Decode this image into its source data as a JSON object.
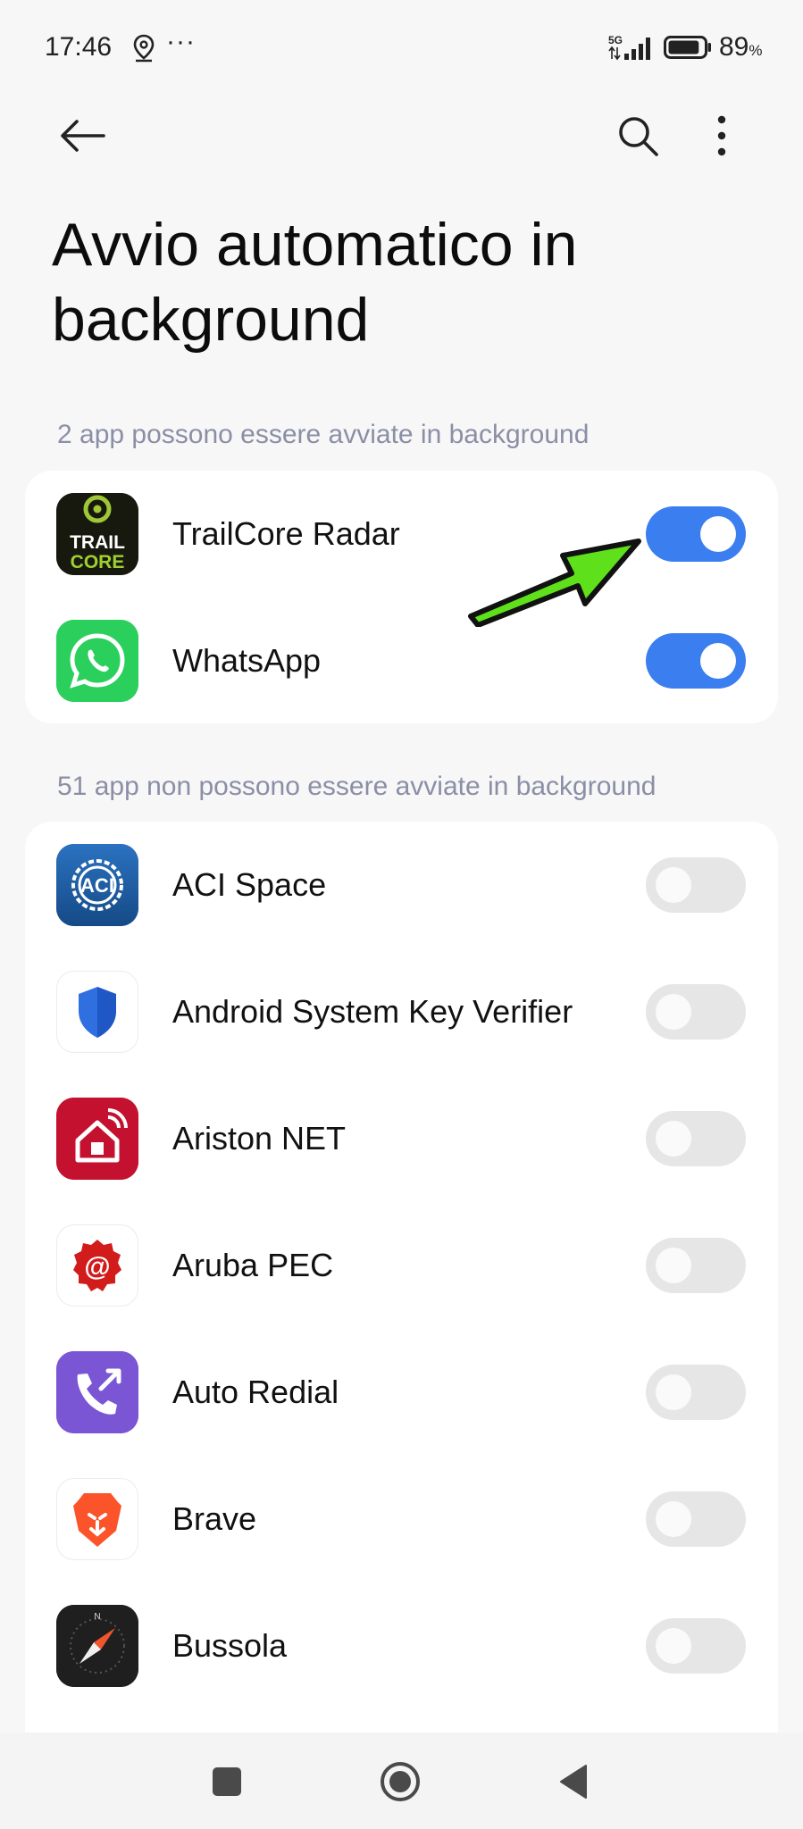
{
  "status_bar": {
    "time": "17:46",
    "dots": "···",
    "network": "5G",
    "battery_percent": "89",
    "battery_unit": "%",
    "battery_level": 0.89
  },
  "header": {
    "title": "Avvio automatico in background",
    "back_icon": "arrow-left-icon",
    "search_icon": "search-icon",
    "more_icon": "more-vertical-icon"
  },
  "enabled_section": {
    "header": "2 app possono essere avviate in background",
    "apps": [
      {
        "name": "TrailCore Radar",
        "enabled": true,
        "icon": "trailcore-icon",
        "icon_text_1": "TRAIL",
        "icon_text_2": "CORE"
      },
      {
        "name": "WhatsApp",
        "enabled": true,
        "icon": "whatsapp-icon"
      }
    ]
  },
  "disabled_section": {
    "header": "51 app non possono essere avviate in background",
    "apps": [
      {
        "name": "ACI Space",
        "enabled": false,
        "icon": "aci-space-icon"
      },
      {
        "name": "Android System Key Verifier",
        "enabled": false,
        "icon": "shield-icon"
      },
      {
        "name": "Ariston NET",
        "enabled": false,
        "icon": "ariston-home-icon"
      },
      {
        "name": "Aruba PEC",
        "enabled": false,
        "icon": "aruba-pec-icon"
      },
      {
        "name": "Auto Redial",
        "enabled": false,
        "icon": "phone-redial-icon"
      },
      {
        "name": "Brave",
        "enabled": false,
        "icon": "brave-lion-icon"
      },
      {
        "name": "Bussola",
        "enabled": false,
        "icon": "compass-icon"
      }
    ]
  },
  "annotation": {
    "icon": "green-arrow-icon",
    "color": "#5ee01a"
  },
  "colors": {
    "toggle_on": "#3a7ef0",
    "toggle_off": "#e6e6e6",
    "section_header": "#8b8fa6"
  },
  "nav_bar": {
    "recent_icon": "square-icon",
    "home_icon": "circle-icon",
    "back_icon": "triangle-back-icon"
  }
}
